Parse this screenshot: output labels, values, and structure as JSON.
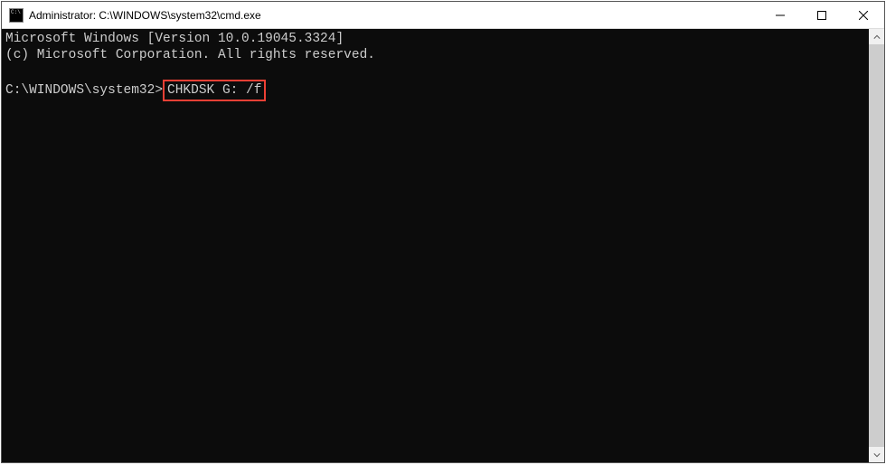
{
  "window": {
    "title": "Administrator: C:\\WINDOWS\\system32\\cmd.exe"
  },
  "terminal": {
    "line1": "Microsoft Windows [Version 10.0.19045.3324]",
    "line2": "(c) Microsoft Corporation. All rights reserved.",
    "prompt": "C:\\WINDOWS\\system32>",
    "command": "CHKDSK G: /f"
  }
}
